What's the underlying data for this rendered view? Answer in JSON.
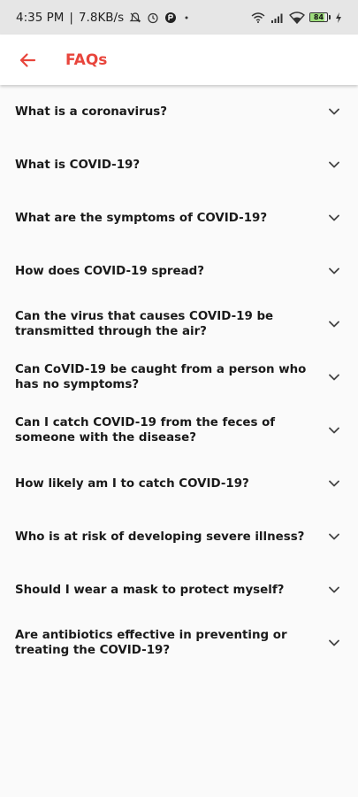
{
  "status_bar": {
    "time": "4:35 PM",
    "separator": "|",
    "net_speed": "7.8KB/s",
    "battery_level": "84",
    "icons": [
      "mute-icon",
      "alarm-icon",
      "app-icon",
      "dot-icon",
      "hotspot-icon",
      "signal-icon",
      "wifi-icon",
      "battery-icon",
      "charging-icon"
    ]
  },
  "app_bar": {
    "title": "FAQs",
    "back_icon": "back-arrow-icon",
    "accent": "#e8453c"
  },
  "faqs": [
    {
      "question": "What is a coronavirus?"
    },
    {
      "question": "What is COVID-19?"
    },
    {
      "question": "What are the symptoms of COVID-19?"
    },
    {
      "question": "How does COVID-19 spread?"
    },
    {
      "question": "Can the virus that causes COVID-19 be transmitted through the air?"
    },
    {
      "question": "Can CoVID-19 be caught from a person who has no symptoms?"
    },
    {
      "question": "Can I catch COVID-19 from the feces of someone with the disease?"
    },
    {
      "question": "How likely am I to catch COVID-19?"
    },
    {
      "question": "Who is at risk of developing severe illness?"
    },
    {
      "question": "Should I wear a mask to protect myself?"
    },
    {
      "question": "Are antibiotics effective in preventing or treating the COVID-19?"
    }
  ]
}
